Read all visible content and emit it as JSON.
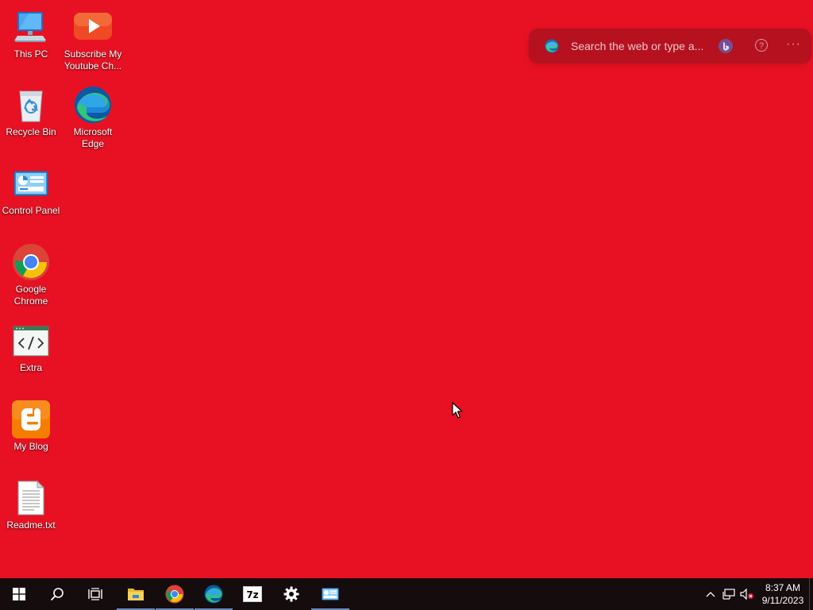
{
  "desktop": {
    "background_color": "#e81123",
    "icons": [
      {
        "label": "This PC"
      },
      {
        "label": "Subscribe My Youtube Ch..."
      },
      {
        "label": "Recycle Bin"
      },
      {
        "label": "Microsoft Edge"
      },
      {
        "label": "Control Panel"
      },
      {
        "label": "Google Chrome"
      },
      {
        "label": "Extra"
      },
      {
        "label": "My Blog"
      },
      {
        "label": "Readme.txt"
      }
    ]
  },
  "search_bar": {
    "placeholder": "Search the web or type a...",
    "help_glyph": "?",
    "more_glyph": "···"
  },
  "taskbar": {
    "pinned": [
      {
        "name": "start",
        "icon": "windows-logo-icon"
      },
      {
        "name": "search",
        "icon": "search-icon"
      },
      {
        "name": "task-view",
        "icon": "task-view-icon"
      },
      {
        "name": "file-explorer",
        "icon": "folder-icon",
        "active": true
      },
      {
        "name": "chrome",
        "icon": "chrome-icon",
        "active": true
      },
      {
        "name": "edge",
        "icon": "edge-icon",
        "active": true
      },
      {
        "name": "7zip",
        "icon": "7zip-icon",
        "label": "7z"
      },
      {
        "name": "settings",
        "icon": "gear-icon"
      },
      {
        "name": "control-panel",
        "icon": "control-panel-icon",
        "active": true
      }
    ],
    "clock": {
      "time": "8:37 AM",
      "date": "9/11/2023"
    }
  }
}
